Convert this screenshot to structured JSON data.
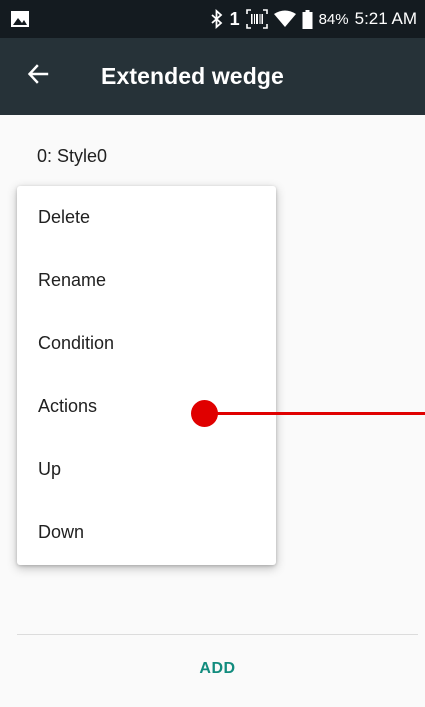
{
  "status_bar": {
    "sim_number": "1",
    "battery_percent": "84%",
    "time": "5:21 AM",
    "icons": [
      "image-icon",
      "bluetooth-icon",
      "barcode-scan-icon",
      "wifi-icon",
      "battery-icon"
    ]
  },
  "app_bar": {
    "title": "Extended wedge",
    "back_icon": "arrow-back-icon"
  },
  "list": {
    "style_label": "0: Style0"
  },
  "menu": {
    "items": [
      {
        "label": "Delete"
      },
      {
        "label": "Rename"
      },
      {
        "label": "Condition"
      },
      {
        "label": "Actions"
      },
      {
        "label": "Up"
      },
      {
        "label": "Down"
      }
    ]
  },
  "footer": {
    "add_label": "ADD"
  },
  "colors": {
    "status_bar": "#141b20",
    "app_bar": "#263238",
    "accent": "#128c7e",
    "touch_indicator": "#e00000"
  }
}
